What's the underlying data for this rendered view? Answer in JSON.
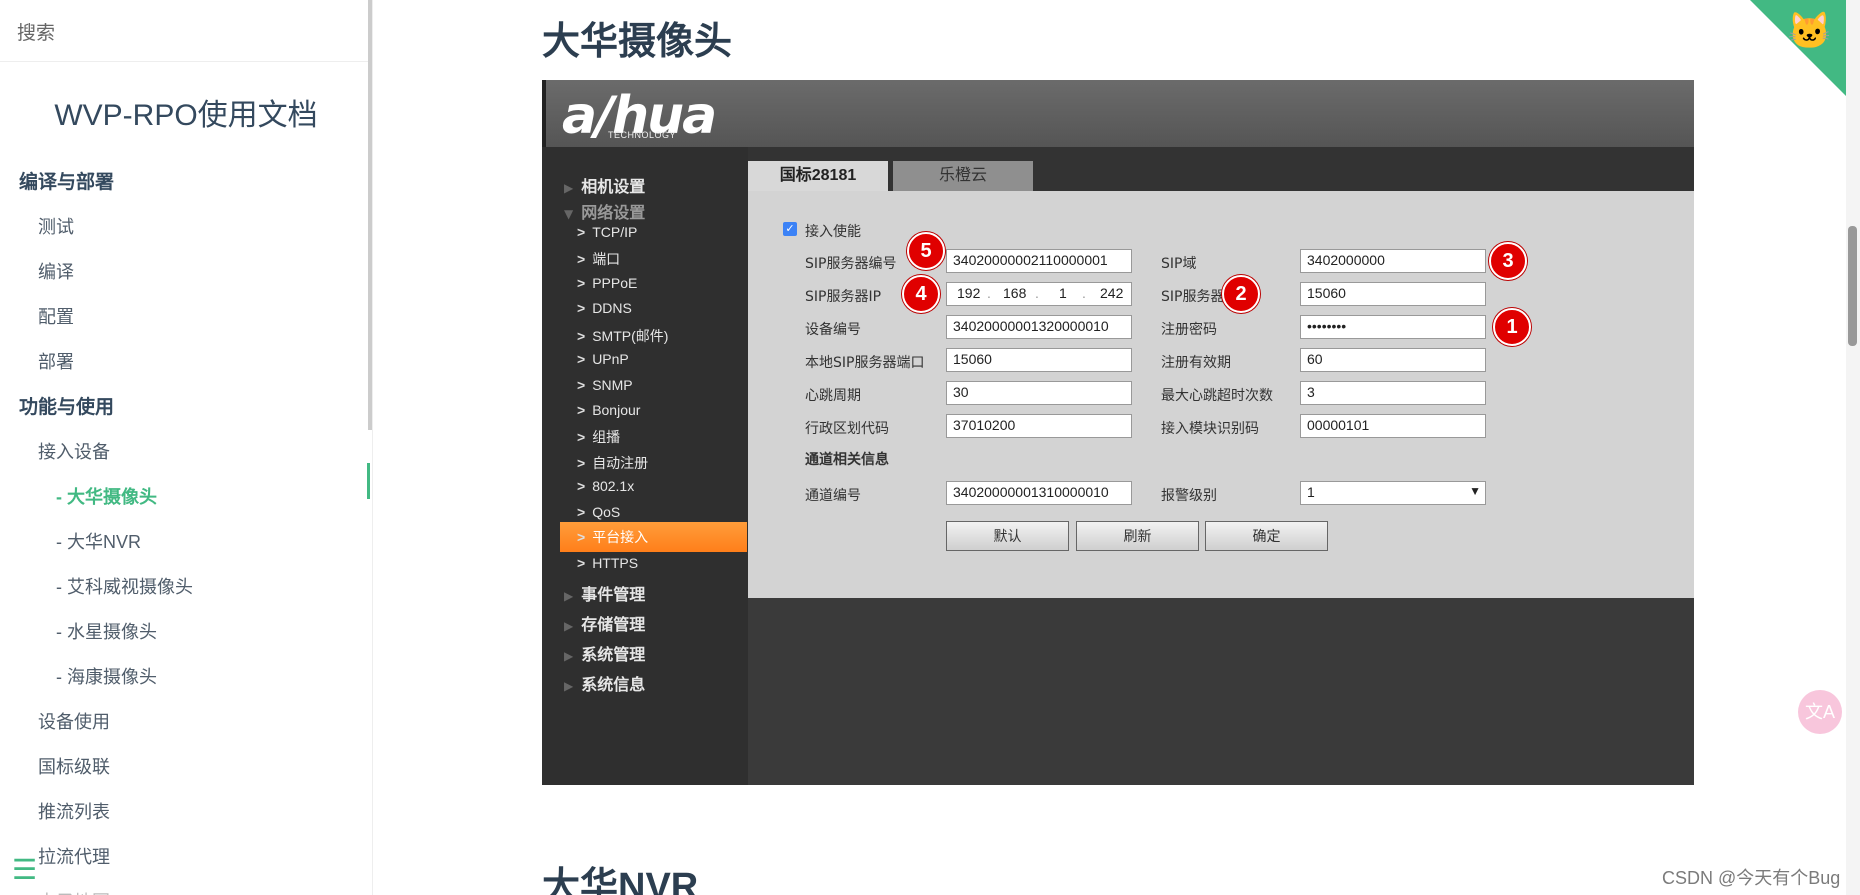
{
  "sidebar": {
    "search_placeholder": "搜索",
    "app_name": "WVP-RPO使用文档",
    "sections": [
      {
        "title": "编译与部署",
        "items": [
          "测试",
          "编译",
          "配置",
          "部署"
        ]
      },
      {
        "title": "功能与使用",
        "items": [
          "接入设备"
        ]
      }
    ],
    "sub_items": [
      "- 大华摄像头",
      "- 大华NVR",
      "- 艾科威视摄像头",
      "- 水星摄像头",
      "- 海康摄像头"
    ],
    "items_after": [
      "设备使用",
      "国标级联",
      "推流列表",
      "拉流代理",
      "电子地图"
    ],
    "active": "- 大华摄像头"
  },
  "main": {
    "heading1": "大华摄像头",
    "heading2": "大华NVR",
    "watermark": "CSDN @今天有个Bug",
    "translate_label": "文A"
  },
  "camera_ui": {
    "logo": "a/hua",
    "logo_sub": "TECHNOLOGY",
    "menu": {
      "camera_settings": "相机设置",
      "network_settings": "网络设置",
      "event": "事件管理",
      "storage": "存储管理",
      "system": "系统管理",
      "info": "系统信息"
    },
    "network_subs": [
      "TCP/IP",
      "端口",
      "PPPoE",
      "DDNS",
      "SMTP(邮件)",
      "UPnP",
      "SNMP",
      "Bonjour",
      "组播",
      "自动注册",
      "802.1x",
      "QoS",
      "平台接入",
      "HTTPS"
    ],
    "tabs": [
      "国标28181",
      "乐橙云"
    ],
    "enable_label": "接入使能",
    "fields": {
      "sip_server_id_label": "SIP服务器编号",
      "sip_server_id": "34020000002110000001",
      "sip_domain_label": "SIP域",
      "sip_domain": "3402000000",
      "sip_server_ip_label": "SIP服务器IP",
      "ip": [
        "192",
        "168",
        "1",
        "242"
      ],
      "sip_server_port_label": "SIP服务器端口",
      "sip_server_port": "15060",
      "device_id_label": "设备编号",
      "device_id": "34020000001320000010",
      "reg_password_label": "注册密码",
      "reg_password": "••••••••",
      "local_port_label": "本地SIP服务器端口",
      "local_port": "15060",
      "reg_validity_label": "注册有效期",
      "reg_validity": "60",
      "heartbeat_label": "心跳周期",
      "heartbeat": "30",
      "max_timeout_label": "最大心跳超时次数",
      "max_timeout": "3",
      "region_label": "行政区划代码",
      "region": "37010200",
      "module_id_label": "接入模块识别码",
      "module_id": "00000101",
      "channel_info_label": "通道相关信息",
      "channel_id_label": "通道编号",
      "channel_id": "34020000001310000010",
      "alarm_level_label": "报警级别",
      "alarm_level": "1"
    },
    "buttons": [
      "默认",
      "刷新",
      "确定"
    ],
    "badges": [
      "1",
      "2",
      "3",
      "4",
      "5"
    ]
  }
}
